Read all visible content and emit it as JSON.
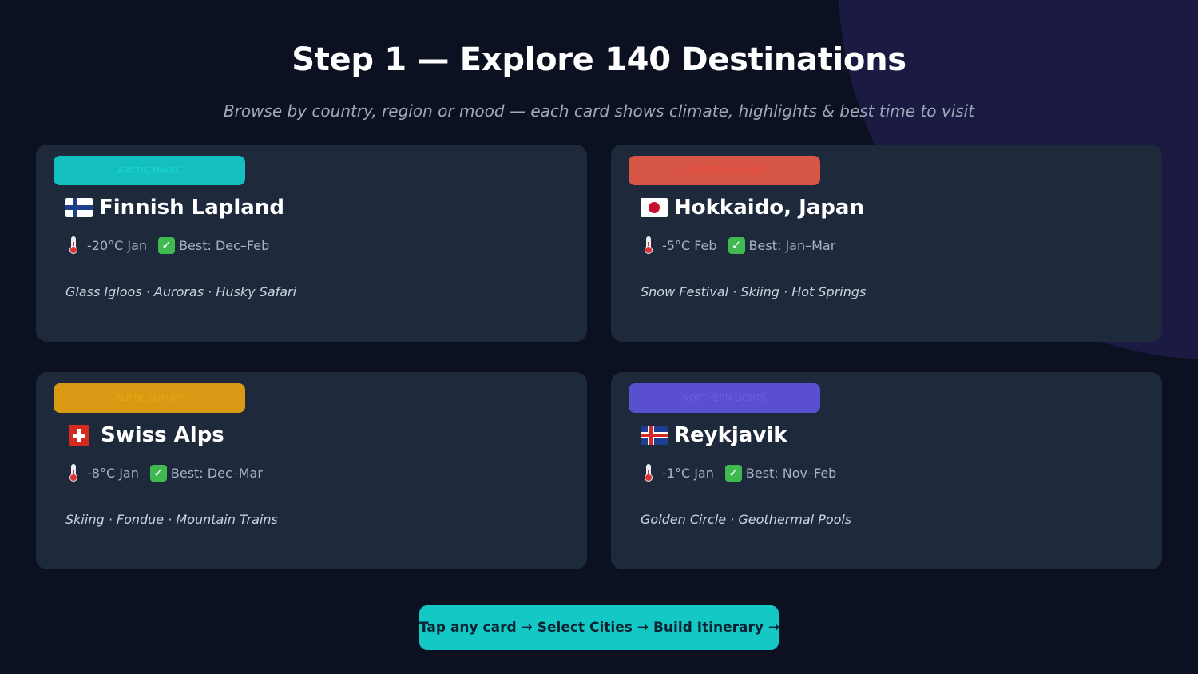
{
  "header": {
    "title": "Step 1 — Explore 140 Destinations",
    "subtitle": "Browse by country, region or mood — each card shows climate, highlights & best time to visit"
  },
  "colors": {
    "background": "#0b1120",
    "card": "#1e2a3c",
    "accent": "#14c8c6"
  },
  "cards": [
    {
      "badge": "ARCTIC MAGIC",
      "badge_color": "#13bfc0",
      "badge_text_color": "#1ad7d4",
      "flag_icon": "finland-flag-icon",
      "name": "Finnish Lapland",
      "temp": "-20°C Jan",
      "best": "Best: Dec–Feb",
      "highlights": "Glass Igloos · Auroras · Husky Safari"
    },
    {
      "badge": "WINTER WONDER",
      "badge_color": "#d65545",
      "badge_text_color": "#ee4a3a",
      "flag_icon": "japan-flag-icon",
      "name": "Hokkaido, Japan",
      "temp": "-5°C Feb",
      "best": "Best: Jan–Mar",
      "highlights": "Snow Festival · Skiing · Hot Springs"
    },
    {
      "badge": "ALPINE LUXURY",
      "badge_color": "#d89914",
      "badge_text_color": "#eaa60e",
      "flag_icon": "switzerland-flag-icon",
      "name": "Swiss Alps",
      "temp": "-8°C Jan",
      "best": "Best: Dec–Mar",
      "highlights": "Skiing · Fondue · Mountain Trains"
    },
    {
      "badge": "NORTHERN LIGHTS",
      "badge_color": "#5a4fcf",
      "badge_text_color": "#6a5fe0",
      "flag_icon": "iceland-flag-icon",
      "name": "Reykjavik",
      "temp": "-1°C Jan",
      "best": "Best: Nov–Feb",
      "highlights": "Golden Circle · Geothermal Pools"
    }
  ],
  "cta": {
    "label": "Tap any card → Select Cities → Build Itinerary →"
  }
}
